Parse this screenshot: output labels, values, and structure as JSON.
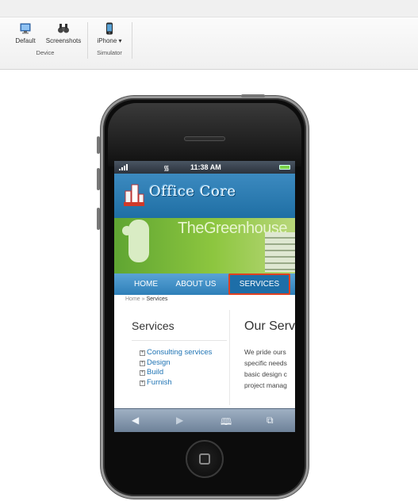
{
  "ribbon": {
    "device_group": {
      "label": "Device",
      "buttons": [
        {
          "label": "Default",
          "icon": "monitor-icon"
        },
        {
          "label": "Screenshots",
          "icon": "binoculars-icon"
        }
      ]
    },
    "simulator_group": {
      "label": "Simulator",
      "buttons": [
        {
          "label": "iPhone ▾",
          "icon": "iphone-icon"
        }
      ]
    }
  },
  "phone": {
    "status_bar": {
      "time": "11:38 AM"
    },
    "site": {
      "logo_text": "Office Core",
      "banner_text": "TheGreenhouse",
      "nav": [
        "HOME",
        "ABOUT US",
        "SERVICES"
      ],
      "active_nav": "SERVICES",
      "breadcrumb": {
        "home": "Home",
        "separator": "»",
        "current": "Services"
      },
      "sidebar_title": "Services",
      "sidebar_items": [
        "Consulting services",
        "Design",
        "Build",
        "Furnish"
      ],
      "main_title": "Our Serv",
      "main_text": [
        "We pride ours",
        "specific needs",
        "basic design c",
        "project manag"
      ]
    },
    "safari_toolbar": {
      "back": "◀",
      "forward": "▶",
      "bookmarks": "🕮",
      "pages": "⧉"
    }
  },
  "colors": {
    "header_blue": "#2e7fb8",
    "active_outline": "#e04020",
    "link_blue": "#1e73b4",
    "banner_green": "#8dc63f"
  }
}
